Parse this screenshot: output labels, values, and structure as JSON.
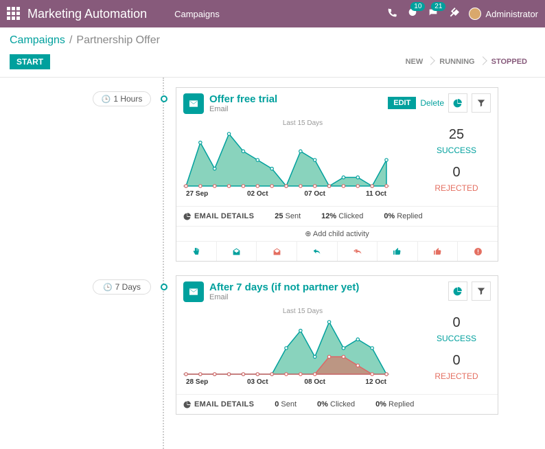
{
  "topbar": {
    "app_title": "Marketing Automation",
    "menu_campaigns": "Campaigns",
    "badge_activities": "10",
    "badge_discuss": "21",
    "user_name": "Administrator"
  },
  "crumb": {
    "link": "Campaigns",
    "sep": "/",
    "current": "Partnership Offer"
  },
  "statusbar": {
    "start": "START",
    "new": "NEW",
    "running": "RUNNING",
    "stopped": "STOPPED"
  },
  "common": {
    "chart_caption": "Last 15 Days",
    "email_details": "EMAIL DETAILS",
    "success": "SUCCESS",
    "rejected": "REJECTED",
    "edit": "EDIT",
    "delete": "Delete",
    "add_child": "Add child activity",
    "sent": "Sent",
    "clicked": "Clicked",
    "replied": "Replied"
  },
  "activities": [
    {
      "delay": "1 Hours",
      "title": "Offer free trial",
      "channel": "Email",
      "success": "25",
      "rejected": "0",
      "sent": "25",
      "clicked": "12%",
      "replied": "0%",
      "x_ticks": [
        "27 Sep",
        "02 Oct",
        "07 Oct",
        "11 Oct"
      ],
      "show_edit": true,
      "show_child": true
    },
    {
      "delay": "7 Days",
      "title": "After 7 days (if not partner yet)",
      "channel": "Email",
      "success": "0",
      "rejected": "0",
      "sent": "0",
      "clicked": "0%",
      "replied": "0%",
      "x_ticks": [
        "28 Sep",
        "03 Oct",
        "08 Oct",
        "12 Oct"
      ],
      "show_edit": false,
      "show_child": false
    }
  ],
  "chart_data": [
    {
      "type": "area",
      "title": "Offer free trial — Last 15 Days",
      "categories": [
        "27 Sep",
        "28 Sep",
        "29 Sep",
        "30 Sep",
        "01 Oct",
        "02 Oct",
        "03 Oct",
        "04 Oct",
        "05 Oct",
        "06 Oct",
        "07 Oct",
        "08 Oct",
        "09 Oct",
        "10 Oct",
        "11 Oct"
      ],
      "series": [
        {
          "name": "Success",
          "values": [
            0,
            5,
            2,
            6,
            4,
            3,
            2,
            0,
            4,
            3,
            0,
            1,
            1,
            0,
            3
          ]
        },
        {
          "name": "Rejected",
          "values": [
            0,
            0,
            0,
            0,
            0,
            0,
            0,
            0,
            0,
            0,
            0,
            0,
            0,
            0,
            0
          ]
        }
      ],
      "ylim": [
        0,
        6
      ]
    },
    {
      "type": "area",
      "title": "After 7 days — Last 15 Days",
      "categories": [
        "28 Sep",
        "29 Sep",
        "30 Sep",
        "01 Oct",
        "02 Oct",
        "03 Oct",
        "04 Oct",
        "05 Oct",
        "06 Oct",
        "07 Oct",
        "08 Oct",
        "09 Oct",
        "10 Oct",
        "11 Oct",
        "12 Oct"
      ],
      "series": [
        {
          "name": "Success",
          "values": [
            0,
            0,
            0,
            0,
            0,
            0,
            0,
            3,
            5,
            2,
            6,
            3,
            4,
            3,
            0
          ]
        },
        {
          "name": "Rejected",
          "values": [
            0,
            0,
            0,
            0,
            0,
            0,
            0,
            0,
            0,
            0,
            2,
            2,
            1,
            0,
            0
          ]
        }
      ],
      "ylim": [
        0,
        6
      ]
    }
  ]
}
